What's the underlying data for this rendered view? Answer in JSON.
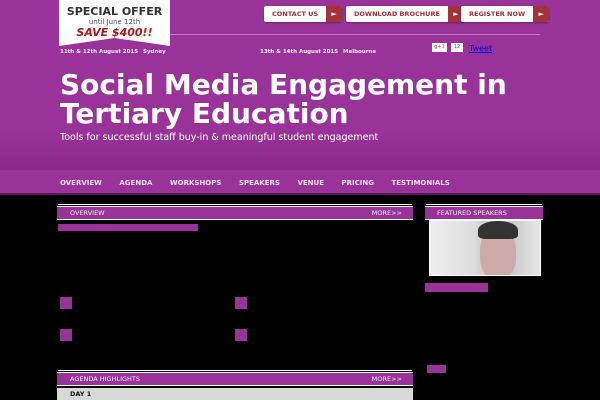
{
  "offer": {
    "title": "SPECIAL OFFER",
    "until": "until June 12th",
    "save": "SAVE $400!!"
  },
  "buttons": [
    {
      "label": "CONTACT US",
      "arrow": "►"
    },
    {
      "label": "DOWNLOAD BROCHURE",
      "arrow": "►"
    },
    {
      "label": "REGISTER NOW",
      "arrow": "►"
    }
  ],
  "events": [
    {
      "date": "11th & 12th August 2015",
      "city": "Sydney"
    },
    {
      "date": "13th & 14th August 2015",
      "city": "Melbourne"
    }
  ],
  "social": {
    "gplus": "g+1",
    "count": "12",
    "tweet": "Tweet"
  },
  "hero": {
    "title": "Social Media Engagement in Tertiary Education",
    "subtitle": "Tools for successful staff buy-in & meaningful student engagement"
  },
  "nav": [
    "OVERVIEW",
    "AGENDA",
    "WORKSHOPS",
    "SPEAKERS",
    "VENUE",
    "PRICING",
    "TESTIMONIALS"
  ],
  "overview": {
    "heading": "OVERVIEW",
    "more": "MORE>>"
  },
  "agenda": {
    "heading": "AGENDA HIGHLIGHTS",
    "more": "MORE>>",
    "day": "DAY 1"
  },
  "speakers": {
    "heading": "FEATURED SPEAKERS"
  },
  "colors": {
    "brand": "#9a3399",
    "button_accent": "#a3323a"
  }
}
